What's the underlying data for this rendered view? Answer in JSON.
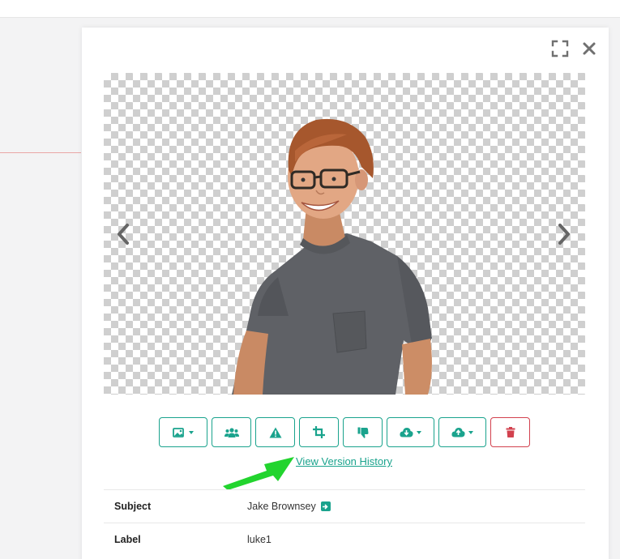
{
  "modal": {
    "icons": {
      "expand": "fullscreen-icon",
      "close": "close-x-icon"
    },
    "viewer": {
      "image_subject": "smiling teen boy with glasses in grey t-shirt on transparent background",
      "prev": "chevron-left-icon",
      "next": "chevron-right-icon"
    },
    "toolbar": [
      {
        "name": "image-menu-button",
        "icon": "image-icon",
        "dropdown": true
      },
      {
        "name": "group-button",
        "icon": "users-icon",
        "dropdown": false
      },
      {
        "name": "flag-issue-button",
        "icon": "warning-triangle-icon",
        "dropdown": false
      },
      {
        "name": "crop-button",
        "icon": "crop-icon",
        "dropdown": false
      },
      {
        "name": "reject-button",
        "icon": "thumbs-down-icon",
        "dropdown": false
      },
      {
        "name": "download-button",
        "icon": "cloud-download-icon",
        "dropdown": true
      },
      {
        "name": "upload-button",
        "icon": "cloud-upload-icon",
        "dropdown": true
      },
      {
        "name": "delete-button",
        "icon": "trash-icon",
        "dropdown": false
      }
    ],
    "version_link": "View Version History",
    "details": [
      {
        "key": "Subject",
        "value": "Jake Brownsey",
        "link_icon": true
      },
      {
        "key": "Label",
        "value": "luke1",
        "link_icon": false
      }
    ]
  },
  "colors": {
    "accent": "#1aa38d",
    "danger": "#d2414e",
    "annotation_arrow": "#22d42e"
  }
}
